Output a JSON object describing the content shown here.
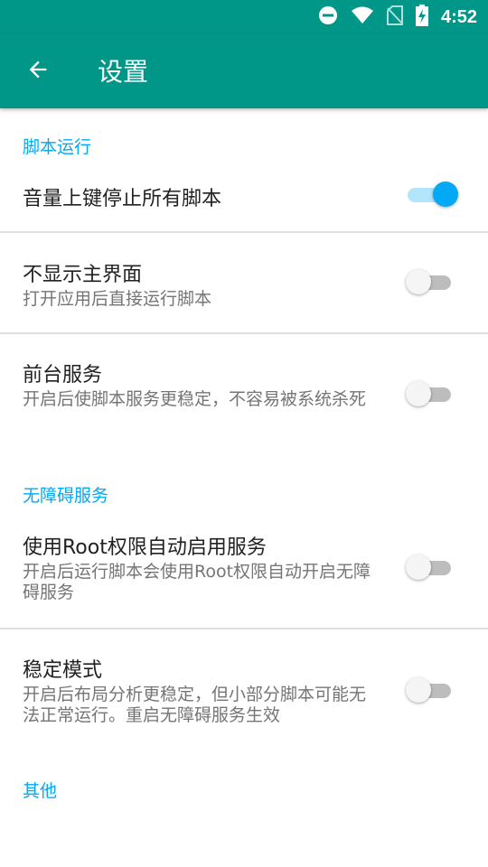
{
  "status_bar": {
    "time": "4:52",
    "icons": [
      "do-not-disturb-icon",
      "wifi-icon",
      "no-sim-icon",
      "battery-charging-icon"
    ]
  },
  "app_bar": {
    "back_icon": "back-arrow-icon",
    "title": "设置"
  },
  "sections": {
    "script_run": "脚本运行",
    "accessibility": "无障碍服务",
    "other": "其他"
  },
  "settings": {
    "volume_stop": {
      "label": "音量上键停止所有脚本",
      "enabled": true
    },
    "hide_main": {
      "label": "不显示主界面",
      "summary": "打开应用后直接运行脚本",
      "enabled": false
    },
    "foreground_service": {
      "label": "前台服务",
      "summary": "开启后使脚本服务更稳定，不容易被系统杀死",
      "enabled": false
    },
    "root_accessibility": {
      "label": "使用Root权限自动启用服务",
      "summary": "开启后运行脚本会使用Root权限自动开启无障碍服务",
      "enabled": false
    },
    "stable_mode": {
      "label": "稳定模式",
      "summary": "开启后布局分析更稳定，但小部分脚本可能无法正常运行。重启无障碍服务生效",
      "enabled": false
    }
  },
  "colors": {
    "primary": "#009688",
    "accent": "#03a9f4",
    "text_primary": "#212121",
    "text_secondary": "#757575"
  }
}
